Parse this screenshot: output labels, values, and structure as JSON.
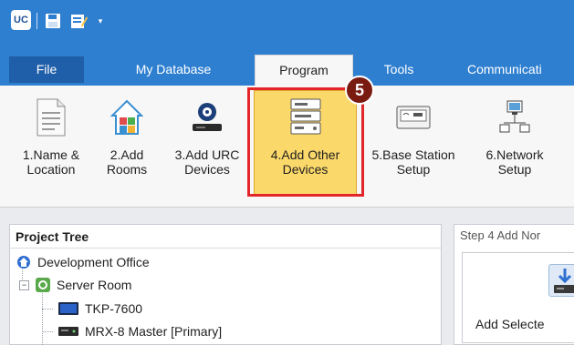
{
  "quick_access": {
    "logo_text": "UC",
    "icons": [
      "app-logo-icon",
      "save-icon",
      "edit-icon",
      "dropdown-arrow-icon"
    ],
    "dropdown_glyph": "▾"
  },
  "tabs": [
    {
      "label": "File",
      "active": false
    },
    {
      "label": "My Database",
      "active": false
    },
    {
      "label": "Program",
      "active": true
    },
    {
      "label": "Tools",
      "active": false
    },
    {
      "label": "Communicati",
      "active": false
    }
  ],
  "ribbon": {
    "buttons": [
      {
        "label": "1.Name &\nLocation",
        "icon": "document-icon"
      },
      {
        "label": "2.Add\nRooms",
        "icon": "house-icon"
      },
      {
        "label": "3.Add URC\nDevices",
        "icon": "remote-device-icon"
      },
      {
        "label": "4.Add Other\nDevices",
        "icon": "av-rack-icon",
        "highlighted": true
      },
      {
        "label": "5.Base Station\nSetup",
        "icon": "base-station-icon"
      },
      {
        "label": "6.Network\nSetup",
        "icon": "network-icon"
      }
    ],
    "step_badge": "5"
  },
  "project_tree": {
    "title": "Project Tree",
    "items": [
      {
        "label": "Development Office",
        "icon": "office-icon",
        "level": 0
      },
      {
        "label": "Server Room",
        "icon": "room-icon",
        "level": 1,
        "expander": "−"
      },
      {
        "label": "TKP-7600",
        "icon": "touch-panel-icon",
        "level": 2
      },
      {
        "label": "MRX-8 Master [Primary]",
        "icon": "controller-icon",
        "level": 2
      }
    ]
  },
  "right_panel": {
    "header": "Step 4 Add Nor",
    "button_label": "Add Selecte"
  },
  "colors": {
    "titlebar": "#2f7fd0",
    "highlight": "#fbd86a",
    "callout_red": "#e3262a",
    "badge": "#7a1b12"
  }
}
